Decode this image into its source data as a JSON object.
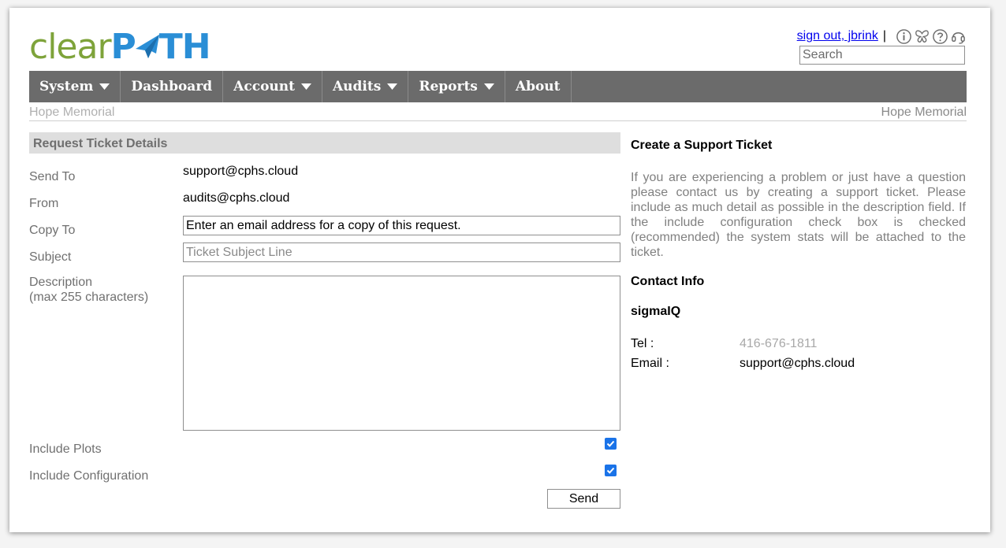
{
  "brand": {
    "logo_light": "clear",
    "logo_bold_1": "P",
    "logo_bold_2": "TH"
  },
  "header": {
    "sign_out_label": "sign out, jbrink",
    "separator": "|",
    "icons": [
      "info-icon",
      "butterfly-icon",
      "help-icon",
      "headset-icon"
    ],
    "search_placeholder": "Search"
  },
  "nav": {
    "items": [
      {
        "label": "System",
        "has_dropdown": true
      },
      {
        "label": "Dashboard",
        "has_dropdown": false
      },
      {
        "label": "Account",
        "has_dropdown": true
      },
      {
        "label": "Audits",
        "has_dropdown": true
      },
      {
        "label": "Reports",
        "has_dropdown": true
      },
      {
        "label": "About",
        "has_dropdown": false
      }
    ]
  },
  "site": {
    "left": "Hope Memorial",
    "right": "Hope Memorial"
  },
  "form": {
    "title": "Request Ticket Details",
    "send_to_label": "Send To",
    "send_to_value": "support@cphs.cloud",
    "from_label": "From",
    "from_value": "audits@cphs.cloud",
    "copy_to_label": "Copy To",
    "copy_to_placeholder": "Enter an email address for a copy of this request.",
    "subject_label": "Subject",
    "subject_placeholder": "Ticket Subject Line",
    "description_label": "Description",
    "description_hint": "(max 255 characters)",
    "description_value": "",
    "include_plots_label": "Include Plots",
    "include_plots_checked": true,
    "include_config_label": "Include Configuration",
    "include_config_checked": true,
    "send_label": "Send"
  },
  "info": {
    "title": "Create a Support Ticket",
    "body": "If you are experiencing a problem or just have a question please contact us by creating a support ticket.  Please include as much detail as possible in the description field.  If the include configuration check box is checked (recommended) the system stats will be attached to the ticket.",
    "contact_title": "Contact Info",
    "company": "sigmaIQ",
    "tel_label": "Tel :",
    "tel_value": "416-676-1811",
    "email_label": "Email :",
    "email_value": "support@cphs.cloud"
  },
  "colors": {
    "logo_green": "#7ea33a",
    "logo_blue": "#2a8ed6",
    "nav_bg": "#6b6b6b",
    "checkbox": "#1a73e8"
  }
}
